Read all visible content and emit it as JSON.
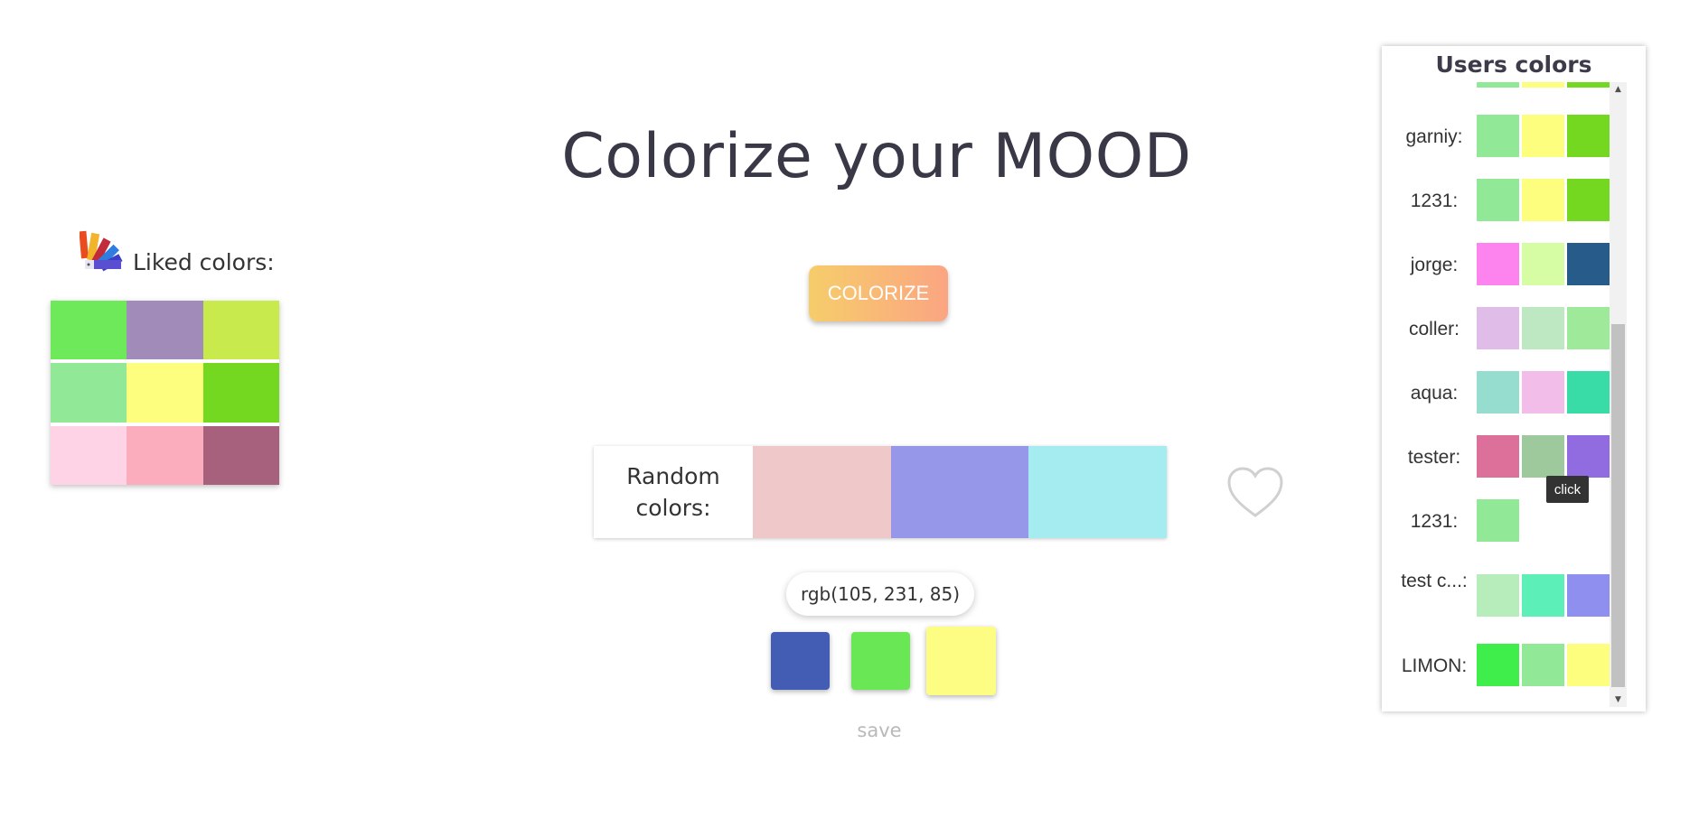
{
  "title": "Colorize your MOOD",
  "colorize_button": "COLORIZE",
  "liked": {
    "title": "Liked colors:",
    "icon": "color-palette-icon",
    "grid": [
      "#6de95a",
      "#a18bb8",
      "#c8ea4d",
      "#91e997",
      "#fdfd7e",
      "#73d81f",
      "#fdd3e5",
      "#fbadbe",
      "#a7617c"
    ]
  },
  "random": {
    "label_line1": "Random",
    "label_line2": "colors:",
    "swatches": [
      "#efc8c9",
      "#9697e8",
      "#a5ecf1"
    ]
  },
  "heart_icon": "heart-icon",
  "rgb_readout": "rgb(105, 231, 85)",
  "picked": [
    "#425db3",
    "#69e755",
    "#fdfd84"
  ],
  "save_label": "save",
  "users": {
    "title": "Users colors",
    "tooltip": "click",
    "rows": [
      {
        "name": "garniy:",
        "colors": [
          "#91e997",
          "#fdfd7e",
          "#73d81f"
        ]
      },
      {
        "name": "1231:",
        "colors": [
          "#91e997",
          "#fdfd7e",
          "#73d81f"
        ]
      },
      {
        "name": "jorge:",
        "colors": [
          "#fd84ef",
          "#d6fda3",
          "#265b8a"
        ]
      },
      {
        "name": "coller:",
        "colors": [
          "#e0bde8",
          "#bee8c2",
          "#9fe99b"
        ]
      },
      {
        "name": "aqua:",
        "colors": [
          "#96dccf",
          "#f3bde9",
          "#39dba6"
        ]
      },
      {
        "name": "tester:",
        "colors": [
          "#dd6f9b",
          "#9dc99d",
          "#916ce1"
        ]
      },
      {
        "name": "1231:",
        "colors": [
          "#91e997"
        ]
      },
      {
        "name": "test c...:",
        "colors": [
          "#b7edba",
          "#5cf0b8",
          "#8f8ff0"
        ]
      },
      {
        "name": "LIMON:",
        "colors": [
          "#3fed4b",
          "#91e997",
          "#fdfd7e"
        ]
      }
    ]
  }
}
